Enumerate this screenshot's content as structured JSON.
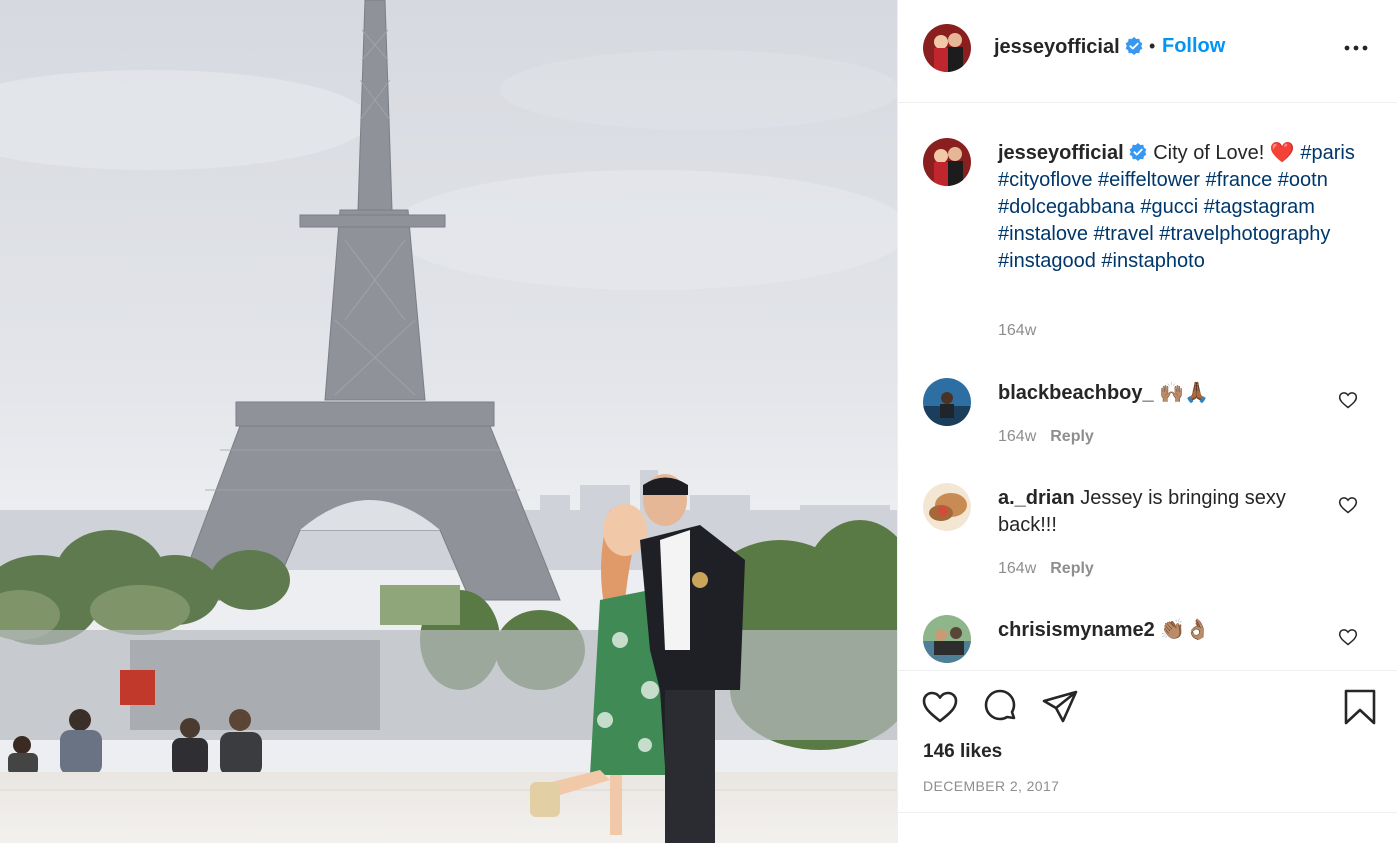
{
  "post": {
    "username": "jesseyofficial",
    "follow_label": "Follow",
    "separator": "•"
  },
  "caption": {
    "username": "jesseyofficial",
    "text": "City of Love! ",
    "emoji": "❤️",
    "hashtags": "#paris #cityoflove #eiffeltower #france #ootn #dolcegabbana #gucci #tagstagram #instalove #travel #travelphotography #instagood #instaphoto",
    "time": "164w"
  },
  "comments": [
    {
      "username": "blackbeachboy_",
      "text": "🙌🏽🙏🏾",
      "time": "164w",
      "reply_label": "Reply"
    },
    {
      "username": "a._drian",
      "text": "Jessey is bringing sexy back!!!",
      "time": "164w",
      "reply_label": "Reply"
    },
    {
      "username": "chrisismyname2",
      "text": "👏🏽👌🏽",
      "time": "",
      "reply_label": ""
    }
  ],
  "stats": {
    "likes": "146 likes",
    "date": "DECEMBER 2, 2017"
  },
  "icons": {
    "verified": "verified-badge-icon",
    "more": "more-options-icon",
    "like": "heart-icon",
    "comment": "comment-icon",
    "share": "share-icon",
    "save": "bookmark-icon"
  },
  "colors": {
    "link_blue": "#0095f6",
    "hashtag": "#00376b",
    "muted": "#8e8e8e",
    "verified": "#3897f0"
  }
}
